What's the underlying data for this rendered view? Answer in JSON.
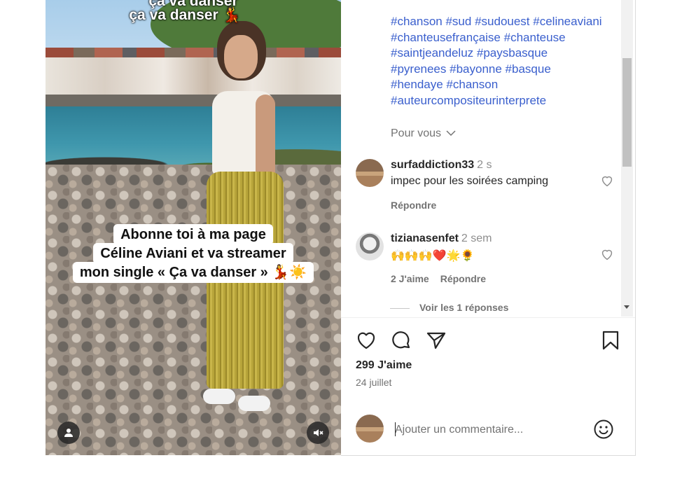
{
  "video": {
    "top_overlay_lines": [
      "ça va danser",
      "ça va danser 💃"
    ],
    "caption_lines": [
      "Abonne toi à ma page",
      "Céline Aviani et va streamer",
      "mon single « Ça va danser » 💃☀️"
    ],
    "icons": {
      "user": "user-icon",
      "mute": "speaker-muted-icon"
    }
  },
  "post": {
    "hashtags": [
      "#chanson",
      "#sud",
      "#sudouest",
      "#celineaviani",
      "#chanteusefrançaise",
      "#chanteuse",
      "#saintjeandeluz",
      "#paysbasque",
      "#pyrenees",
      "#bayonne",
      "#basque",
      "#hendaye",
      "#chanson",
      "#auteurcompositeurinterprete"
    ],
    "more_label": "Pour vous",
    "hashtag_color": "#3a5fcd"
  },
  "comments": [
    {
      "username": "surfaddiction33",
      "time": "2 s",
      "text": "impec pour les soirées camping",
      "reply_label": "Répondre"
    },
    {
      "username": "tizianasenfet",
      "time": "2 sem",
      "text": "🙌🙌🙌❤️🌟🌻",
      "likes_label": "2 J'aime",
      "reply_label": "Répondre"
    }
  ],
  "view_replies_label": "Voir les 1 réponses",
  "actions": {
    "like": "heart-icon",
    "comment": "comment-bubble-icon",
    "share": "paper-plane-icon",
    "save": "bookmark-icon"
  },
  "likes_text": "299 J'aime",
  "date_text": "24 juillet",
  "add_comment": {
    "placeholder": "Ajouter un commentaire..."
  }
}
